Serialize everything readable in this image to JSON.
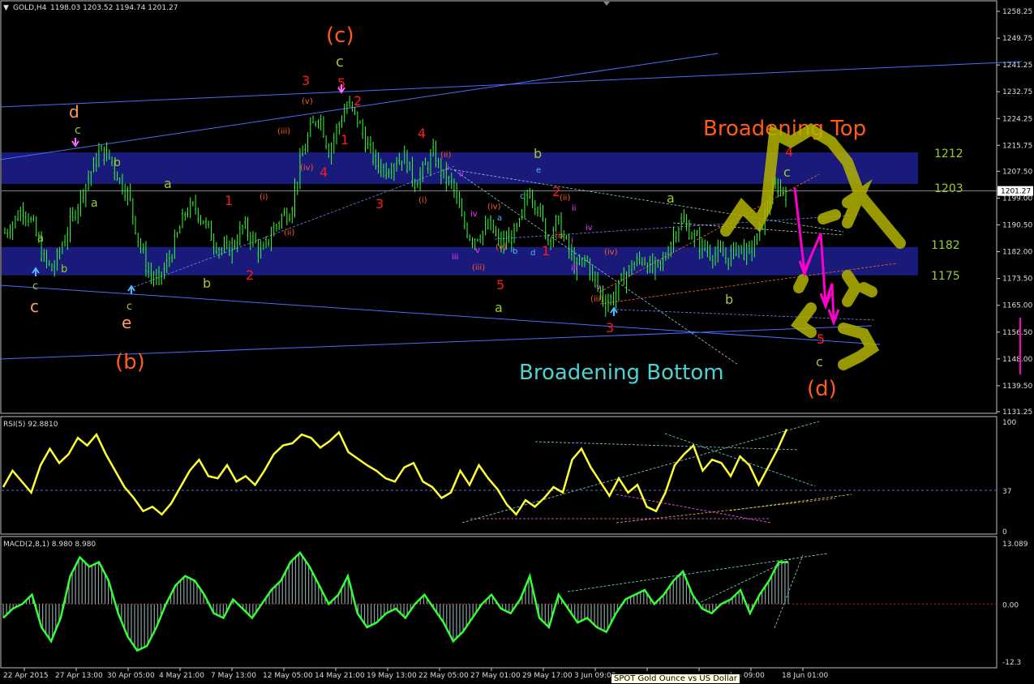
{
  "window": {
    "symbol_header": "GOLD,H4",
    "ohlc": "1198.03 1203.52 1194.74 1201.27",
    "tooltip": "SPOT Gold Ounce vs US Dollar"
  },
  "colors": {
    "background": "#000000",
    "candle": "#33ff33",
    "rsi_line": "#ffff33",
    "macd_line": "#33ff33",
    "macd_hist": "#8aa0a0",
    "zone": "#1a1a7a",
    "channel": "#4d6bff",
    "wave_red": "#ff1a1a",
    "wave_orange": "#ff5a1a",
    "wave_yellowgreen": "#99cc33",
    "wave_salmon": "#ff9966",
    "wave_magenta": "#ff33ff",
    "arrow_magenta": "#ff00cc",
    "scribble": "#b3b300",
    "broadening_bottom": "#4dd2d2"
  },
  "chart_data": [
    {
      "type": "candlestick",
      "title": "GOLD,H4",
      "price_axis_ticks": [
        "1258.25",
        "1249.75",
        "1241.25",
        "1232.75",
        "1224.25",
        "1215.75",
        "1207.50",
        "1199.00",
        "1190.50",
        "1182.00",
        "1173.50",
        "1165.00",
        "1156.50",
        "1148.00",
        "1139.50",
        "1131.25"
      ],
      "ylim": [
        1131.25,
        1258.25
      ],
      "current_price": "1201.27",
      "time_axis_ticks": [
        "22 Apr 2015",
        "27 Apr 13:00",
        "30 Apr 05:00",
        "4 May 21:00",
        "7 May 13:00",
        "12 May 05:00",
        "14 May 21:00",
        "19 May 13:00",
        "22 May 05:00",
        "27 May 01:00",
        "29 May 17:00",
        "3 Jun 09:00",
        "",
        "",
        "Jun 09:00",
        "18 Jun 01:00"
      ],
      "close_series": [
        1188,
        1192,
        1196,
        1190,
        1180,
        1176,
        1184,
        1192,
        1200,
        1207,
        1214,
        1212,
        1205,
        1200,
        1186,
        1176,
        1172,
        1178,
        1186,
        1195,
        1196,
        1191,
        1185,
        1182,
        1184,
        1190,
        1186,
        1181,
        1188,
        1193,
        1195,
        1210,
        1220,
        1226,
        1214,
        1222,
        1229,
        1224,
        1216,
        1210,
        1208,
        1211,
        1212,
        1204,
        1208,
        1213,
        1206,
        1203,
        1192,
        1186,
        1188,
        1190,
        1184,
        1186,
        1190,
        1202,
        1196,
        1186,
        1192,
        1184,
        1176,
        1180,
        1172,
        1166,
        1168,
        1174,
        1178,
        1180,
        1176,
        1178,
        1186,
        1192,
        1188,
        1184,
        1182,
        1181,
        1180,
        1184,
        1181,
        1186,
        1196,
        1203,
        1201
      ],
      "zones": [
        {
          "top": 1213.5,
          "bottom": 1203.5,
          "label": "1212",
          "label2": "1203"
        },
        {
          "top": 1183.5,
          "bottom": 1174.5,
          "label": "1182",
          "label2": "1175"
        }
      ],
      "annotations": {
        "broadening_top": "Broadening Top",
        "broadening_bottom": "Broadening Bottom",
        "big_c": "(c)",
        "big_b": "(b)",
        "big_d": "(d)",
        "level_1212": "1212",
        "level_1203": "1203",
        "level_1182": "1182",
        "level_1175": "1175"
      },
      "wave_labels": [
        {
          "t": "d",
          "c": "salmon",
          "s": 20
        },
        {
          "t": "c",
          "c": "yg",
          "s": 14
        },
        {
          "t": "b",
          "c": "yg",
          "s": 14
        },
        {
          "t": "a",
          "c": "yg",
          "s": 14
        },
        {
          "t": "a",
          "c": "yg",
          "s": 13
        },
        {
          "t": "b",
          "c": "yg",
          "s": 13
        },
        {
          "t": "c",
          "c": "yg",
          "s": 13
        },
        {
          "t": "c",
          "c": "salmon",
          "s": 20
        },
        {
          "t": "c",
          "c": "yg",
          "s": 13
        },
        {
          "t": "e",
          "c": "salmon",
          "s": 20
        },
        {
          "t": "a",
          "c": "yg",
          "s": 16
        },
        {
          "t": "b",
          "c": "yg",
          "s": 16
        },
        {
          "t": "1",
          "c": "red",
          "s": 16
        },
        {
          "t": "2",
          "c": "red",
          "s": 16
        },
        {
          "t": "3",
          "c": "red",
          "s": 16
        },
        {
          "t": "5",
          "c": "red",
          "s": 16
        },
        {
          "t": "c",
          "c": "yg",
          "s": 18
        },
        {
          "t": "2",
          "c": "red",
          "s": 16
        },
        {
          "t": "1",
          "c": "red",
          "s": 16
        },
        {
          "t": "4",
          "c": "red",
          "s": 16
        },
        {
          "t": "3",
          "c": "red",
          "s": 16
        },
        {
          "t": "4",
          "c": "red",
          "s": 16
        },
        {
          "t": "(iii)",
          "c": "orange",
          "s": 10
        },
        {
          "t": "(v)",
          "c": "orange",
          "s": 10
        },
        {
          "t": "(iv)",
          "c": "orange",
          "s": 10
        },
        {
          "t": "(i)",
          "c": "orange",
          "s": 10
        },
        {
          "t": "(ii)",
          "c": "orange",
          "s": 10
        },
        {
          "t": "(ii)",
          "c": "orange",
          "s": 10
        },
        {
          "t": "(i)",
          "c": "orange",
          "s": 10
        },
        {
          "t": "b",
          "c": "yg",
          "s": 16
        },
        {
          "t": "e",
          "c": "cyan",
          "s": 10
        },
        {
          "t": "2",
          "c": "red",
          "s": 16
        },
        {
          "t": "1",
          "c": "red",
          "s": 16
        },
        {
          "t": "5",
          "c": "red",
          "s": 16
        },
        {
          "t": "a",
          "c": "yg",
          "s": 16
        },
        {
          "t": "ii",
          "c": "mag",
          "s": 10
        },
        {
          "t": "i",
          "c": "mag",
          "s": 10
        },
        {
          "t": "iii",
          "c": "mag",
          "s": 10
        },
        {
          "t": "iv",
          "c": "mag",
          "s": 10
        },
        {
          "t": "v",
          "c": "mag",
          "s": 10
        },
        {
          "t": "iii",
          "c": "mag",
          "s": 10
        },
        {
          "t": "iv",
          "c": "mag",
          "s": 10
        },
        {
          "t": "ii",
          "c": "mag",
          "s": 10
        },
        {
          "t": "i",
          "c": "mag",
          "s": 10
        },
        {
          "t": "v",
          "c": "mag",
          "s": 10
        },
        {
          "t": "(iii)",
          "c": "orange",
          "s": 10
        },
        {
          "t": "(iv)",
          "c": "orange",
          "s": 10
        },
        {
          "t": "(v)",
          "c": "orange",
          "s": 10
        },
        {
          "t": "(iii)",
          "c": "orange",
          "s": 10
        },
        {
          "t": "(iv)",
          "c": "orange",
          "s": 10
        },
        {
          "t": "(ii)",
          "c": "orange",
          "s": 10
        },
        {
          "t": "(i)",
          "c": "orange",
          "s": 10
        },
        {
          "t": "a",
          "c": "cyan",
          "s": 10
        },
        {
          "t": "b",
          "c": "cyan",
          "s": 10
        },
        {
          "t": "c",
          "c": "cyan",
          "s": 10
        },
        {
          "t": "d",
          "c": "cyan",
          "s": 10
        },
        {
          "t": "3",
          "c": "red",
          "s": 16
        },
        {
          "t": "a",
          "c": "yg",
          "s": 16
        },
        {
          "t": "b",
          "c": "yg",
          "s": 16
        },
        {
          "t": "4",
          "c": "red",
          "s": 16
        },
        {
          "t": "c",
          "c": "yg",
          "s": 16
        },
        {
          "t": "5",
          "c": "red",
          "s": 16
        },
        {
          "t": "c",
          "c": "yg",
          "s": 16
        }
      ]
    },
    {
      "type": "line",
      "title": "RSI(5) 92.8810",
      "ticks": [
        "100",
        "37",
        "0"
      ],
      "ylim": [
        0,
        100
      ],
      "level": 37,
      "values": [
        40,
        55,
        45,
        35,
        60,
        75,
        62,
        70,
        85,
        78,
        88,
        70,
        55,
        40,
        30,
        18,
        22,
        15,
        25,
        40,
        55,
        65,
        50,
        48,
        60,
        45,
        50,
        42,
        55,
        70,
        78,
        80,
        88,
        85,
        76,
        82,
        90,
        72,
        66,
        60,
        55,
        48,
        45,
        58,
        62,
        45,
        40,
        30,
        35,
        55,
        42,
        60,
        48,
        38,
        24,
        15,
        28,
        22,
        30,
        40,
        35,
        65,
        75,
        58,
        45,
        32,
        48,
        35,
        42,
        22,
        18,
        35,
        60,
        70,
        78,
        55,
        65,
        62,
        50,
        68,
        60,
        42,
        58,
        74,
        92.88
      ]
    },
    {
      "type": "bar",
      "title": "MACD(2,8,1) 8.980 8.980",
      "ticks": [
        "13.089",
        "0.00",
        "-12.3"
      ],
      "ylim": [
        -12.3,
        13.089
      ],
      "values": [
        -3,
        -1,
        0,
        2,
        -5,
        -8,
        -3,
        6,
        10,
        8,
        9,
        5,
        -2,
        -7,
        -10,
        -9,
        -5,
        0,
        4,
        6,
        5,
        2,
        -2,
        -3,
        1,
        -1,
        -3,
        0,
        3,
        5,
        9,
        11,
        8,
        4,
        0,
        2,
        6,
        -2,
        -5,
        -4,
        -2,
        -1,
        -3,
        0,
        2,
        -1,
        -4,
        -8,
        -6,
        -3,
        0,
        2,
        -1,
        -2,
        1,
        6,
        -3,
        -5,
        2,
        -1,
        -4,
        -3,
        -5,
        -6,
        -2,
        1,
        2,
        3,
        0,
        2,
        5,
        7,
        2,
        -1,
        -2,
        0,
        1,
        3,
        -2,
        2,
        5,
        9,
        8.98
      ]
    }
  ]
}
